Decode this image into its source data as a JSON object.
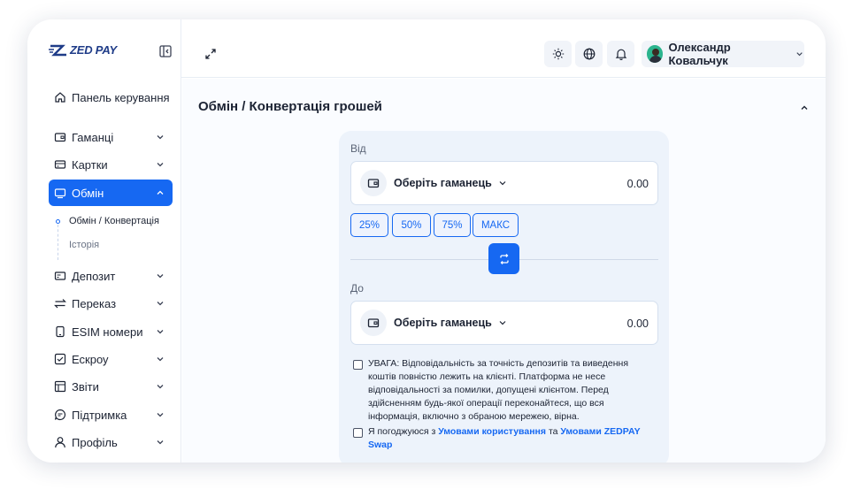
{
  "logo": {
    "text": "ZED PAY"
  },
  "sidebar": {
    "items": [
      {
        "label": "Панель керування",
        "icon": "home-icon"
      },
      {
        "label": "Гаманці",
        "icon": "wallet-icon"
      },
      {
        "label": "Картки",
        "icon": "card-icon"
      },
      {
        "label": "Обмін",
        "icon": "exchange-icon"
      },
      {
        "label": "Депозит",
        "icon": "deposit-icon"
      },
      {
        "label": "Переказ",
        "icon": "transfer-icon"
      },
      {
        "label": "ESIM номери",
        "icon": "sim-icon"
      },
      {
        "label": "Ескроу",
        "icon": "escrow-icon"
      },
      {
        "label": "Звіти",
        "icon": "reports-icon"
      },
      {
        "label": "Підтримка",
        "icon": "support-icon"
      },
      {
        "label": "Профіль",
        "icon": "profile-icon"
      }
    ],
    "submenu": [
      {
        "label": "Обмін / Конвертація"
      },
      {
        "label": "Історія"
      }
    ]
  },
  "header": {
    "user_name": "Олександр Ковальчук"
  },
  "page": {
    "title": "Обмін / Конвертація грошей"
  },
  "exchange": {
    "from_label": "Від",
    "to_label": "До",
    "from_wallet": {
      "placeholder": "Оберіть гаманець",
      "amount": "0.00"
    },
    "to_wallet": {
      "placeholder": "Оберіть гаманець",
      "amount": "0.00"
    },
    "percent_buttons": [
      "25%",
      "50%",
      "75%",
      "МАКС"
    ],
    "warning_text": "УВАГА: Відповідальність за точність депозитів та виведення коштів повністю лежить на клієнті. Платформа не несе відповідальності за помилки, допущені клієнтом. Перед здійсненням будь-якої операції переконайтеся, що вся інформація, включно з обраною мережею, вірна.",
    "agree_prefix": "Я погоджуюся з",
    "agree_link1": "Умовами користування",
    "agree_mid": "та",
    "agree_link2": "Умовами ZEDPAY Swap"
  },
  "colors": {
    "accent": "#1668f2",
    "card_bg": "#edf3fb",
    "text": "#1c2333"
  }
}
